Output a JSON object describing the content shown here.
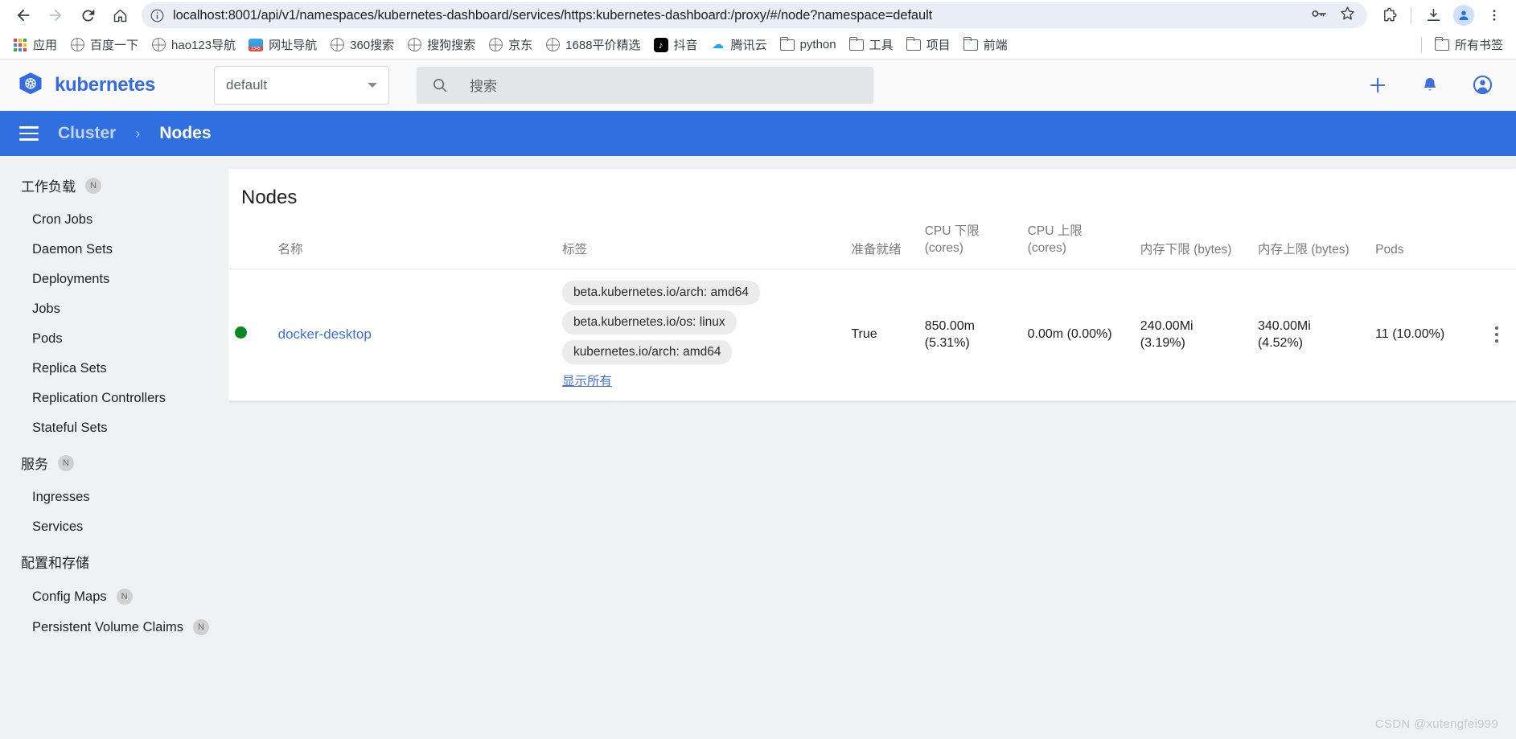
{
  "browser": {
    "nav": {
      "back": "back-arrow",
      "forward": "forward-arrow",
      "reload": "reload",
      "home": "home"
    },
    "omnibox": {
      "site_info_icon": "info-circle-icon",
      "url": "localhost:8001/api/v1/namespaces/kubernetes-dashboard/services/https:kubernetes-dashboard:/proxy/#/node?namespace=default",
      "icons": [
        "password-key-icon",
        "bookmark-star-icon"
      ]
    },
    "toolbar_right": {
      "extensions": "extensions-puzzle-icon",
      "downloads": "downloads-icon",
      "profile": "profile-avatar-icon",
      "menu": "browser-menu-icon"
    },
    "bookmarks": [
      {
        "label": "应用",
        "icon": "apps-grid-icon"
      },
      {
        "label": "百度一下",
        "icon": "globe-icon"
      },
      {
        "label": "hao123导航",
        "icon": "globe-icon"
      },
      {
        "label": "网址导航",
        "icon": "2345-icon"
      },
      {
        "label": "360搜索",
        "icon": "globe-icon"
      },
      {
        "label": "搜狗搜索",
        "icon": "globe-icon"
      },
      {
        "label": "京东",
        "icon": "globe-icon"
      },
      {
        "label": "1688平价精选",
        "icon": "globe-icon"
      },
      {
        "label": "抖音",
        "icon": "douyin-icon"
      },
      {
        "label": "腾讯云",
        "icon": "tencent-cloud-icon"
      },
      {
        "label": "python",
        "icon": "folder-icon"
      },
      {
        "label": "工具",
        "icon": "folder-icon"
      },
      {
        "label": "项目",
        "icon": "folder-icon"
      },
      {
        "label": "前端",
        "icon": "folder-icon"
      }
    ],
    "all_bookmarks": {
      "label": "所有书签",
      "icon": "folder-icon"
    }
  },
  "header": {
    "brand": "kubernetes",
    "brand_icon": "kubernetes-helm-logo",
    "namespace_value": "default",
    "search_placeholder": "搜索",
    "search_icon": "search-icon",
    "create_icon": "plus-icon",
    "notifications_icon": "bell-icon",
    "account_icon": "account-circle-icon"
  },
  "breadcrumb": {
    "menu_icon": "hamburger-menu-icon",
    "parent": "Cluster",
    "separator": "›",
    "current": "Nodes"
  },
  "sidebar": {
    "sections": [
      {
        "label": "工作负载",
        "badge": "N",
        "items": [
          {
            "label": "Cron Jobs"
          },
          {
            "label": "Daemon Sets"
          },
          {
            "label": "Deployments"
          },
          {
            "label": "Jobs"
          },
          {
            "label": "Pods"
          },
          {
            "label": "Replica Sets"
          },
          {
            "label": "Replication Controllers"
          },
          {
            "label": "Stateful Sets"
          }
        ]
      },
      {
        "label": "服务",
        "badge": "N",
        "items": [
          {
            "label": "Ingresses"
          },
          {
            "label": "Services"
          }
        ]
      },
      {
        "label": "配置和存储",
        "badge": "",
        "items": [
          {
            "label": "Config Maps",
            "badge": "N"
          },
          {
            "label": "Persistent Volume Claims",
            "badge": "N"
          }
        ]
      }
    ]
  },
  "main": {
    "card_title": "Nodes",
    "columns": [
      "",
      "名称",
      "标签",
      "准备就绪",
      "CPU 下限 (cores)",
      "CPU 上限 (cores)",
      "内存下限 (bytes)",
      "内存上限 (bytes)",
      "Pods",
      ""
    ],
    "columns_split": {
      "cpu_req_l1": "CPU 下限",
      "cpu_req_l2": "(cores)",
      "cpu_lim_l1": "CPU 上限",
      "cpu_lim_l2": "(cores)"
    },
    "rows": [
      {
        "status": "ready",
        "status_color": "#0a8a20",
        "name": "docker-desktop",
        "labels": [
          "beta.kubernetes.io/arch: amd64",
          "beta.kubernetes.io/os: linux",
          "kubernetes.io/arch: amd64"
        ],
        "labels_show_all": "显示所有",
        "ready": "True",
        "cpu_request_l1": "850.00m",
        "cpu_request_l2": "(5.31%)",
        "cpu_limit": "0.00m (0.00%)",
        "mem_request_l1": "240.00Mi",
        "mem_request_l2": "(3.19%)",
        "mem_limit_l1": "340.00Mi",
        "mem_limit_l2": "(4.52%)",
        "pods": "11 (10.00%)",
        "menu_icon": "kebab-menu-icon"
      }
    ]
  },
  "watermark": "CSDN @xutengfei999"
}
